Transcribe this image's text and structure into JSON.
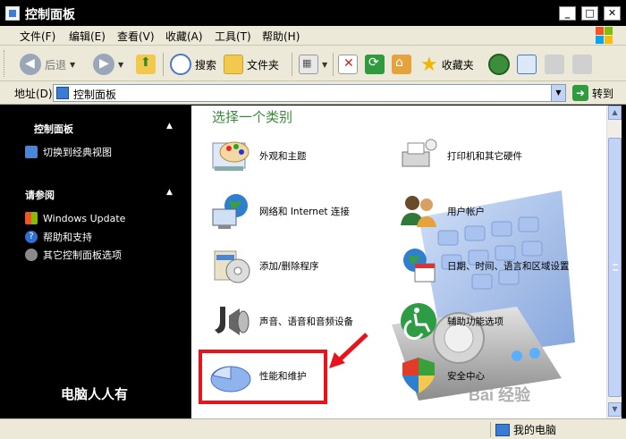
{
  "window": {
    "title": "控制面板"
  },
  "menu": {
    "items": [
      "文件(F)",
      "编辑(E)",
      "查看(V)",
      "收藏(A)",
      "工具(T)",
      "帮助(H)"
    ]
  },
  "toolbar": {
    "back_label": "后退",
    "search_label": "搜索",
    "folders_label": "文件夹",
    "favorites_label": "收藏夹"
  },
  "address": {
    "label": "地址(D)",
    "value": "控制面板",
    "go_label": "转到"
  },
  "sidebar": {
    "section1": {
      "title": "控制面板",
      "links": [
        "切换到经典视图"
      ]
    },
    "section2": {
      "title": "请参阅",
      "links": [
        "Windows Update",
        "帮助和支持",
        "其它控制面板选项"
      ]
    },
    "watermark": "电脑人人有"
  },
  "main": {
    "heading": "选择一个类别",
    "categories": [
      "外观和主题",
      "打印机和其它硬件",
      "网络和 Internet 连接",
      "用户帐户",
      "添加/删除程序",
      "日期、时间、语言和区域设置",
      "声音、语音和音频设备",
      "辅助功能选项",
      "性能和维护",
      "安全中心"
    ],
    "baidu_watermark": "Bai 经验"
  },
  "status": {
    "computer_label": "我的电脑"
  },
  "colors": {
    "heading_green": "#3a8a3a",
    "highlight_red": "#e8141c",
    "panel_black": "#000000"
  }
}
